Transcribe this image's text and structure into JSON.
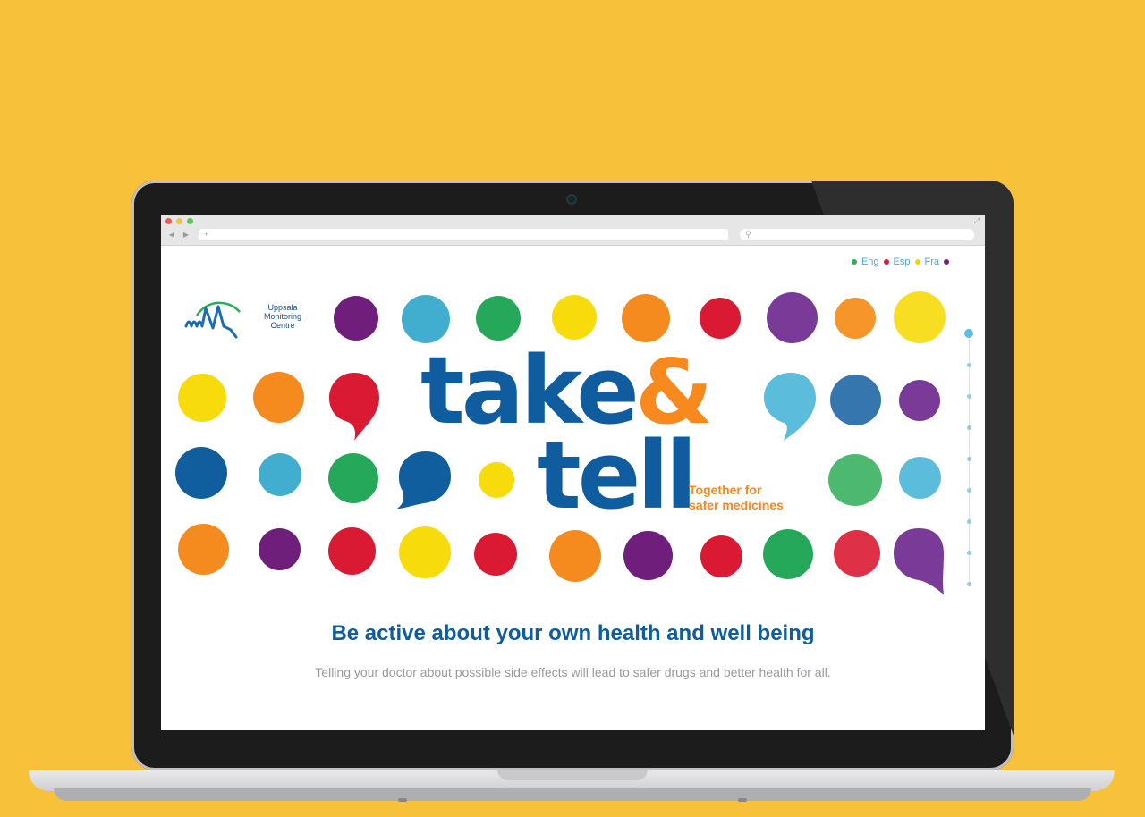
{
  "browser": {
    "address_placeholder": "+",
    "search_icon": "search-icon"
  },
  "languages": [
    {
      "label": "Eng",
      "color": "#2BAE5C"
    },
    {
      "label": "Esp",
      "color": "#D91A32"
    },
    {
      "label": "Fra",
      "color": "#F4D400"
    }
  ],
  "logo": {
    "line1": "Uppsala",
    "line2": "Monitoring",
    "line3": "Centre"
  },
  "hero": {
    "word1": "take",
    "ampersand": "&",
    "word2": "tell",
    "tagline_line1": "Together for",
    "tagline_line2": "safer medicines"
  },
  "content": {
    "headline": "Be active about your own health and well being",
    "subline": "Telling your doctor about possible side effects will lead to safer drugs and better health for all."
  },
  "colors": {
    "blue": "#0F5C9E",
    "orange": "#F7891F",
    "background": "#F8C13A"
  }
}
